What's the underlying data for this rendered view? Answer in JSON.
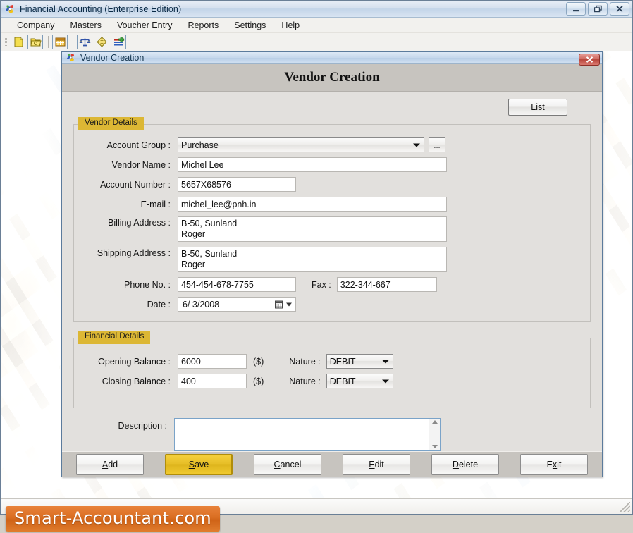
{
  "app": {
    "title": "Financial Accounting (Enterprise Edition)",
    "icon": "app-logo-icon",
    "window_buttons": {
      "minimize": "Minimize",
      "restore": "Restore",
      "close": "Close"
    },
    "menu": [
      {
        "label": "Company"
      },
      {
        "label": "Masters"
      },
      {
        "label": "Voucher Entry"
      },
      {
        "label": "Reports"
      },
      {
        "label": "Settings"
      },
      {
        "label": "Help"
      }
    ],
    "toolbar": [
      {
        "name": "new-document-icon",
        "tip": "New"
      },
      {
        "name": "open-folder-icon",
        "tip": "Open"
      },
      {
        "name": "calendar-grid-icon",
        "tip": "Calendar"
      },
      {
        "name": "balance-scale-icon",
        "tip": "Trial Balance"
      },
      {
        "name": "ledger-book-icon",
        "tip": "Ledger"
      },
      {
        "name": "add-entry-icon",
        "tip": "Add Entry"
      }
    ]
  },
  "dialog": {
    "titlebar_text": "Vendor Creation",
    "close_label": "x",
    "heading": "Vendor Creation",
    "list_button": {
      "prefix": "",
      "accel": "L",
      "rest": "ist",
      "full": "List"
    },
    "vendor_details": {
      "legend": "Vendor Details",
      "fields": {
        "account_group": {
          "label": "Account Group :",
          "value": "Purchase",
          "browse_label": "..."
        },
        "vendor_name": {
          "label": "Vendor Name :",
          "value": "Michel Lee"
        },
        "account_number": {
          "label": "Account Number :",
          "value": "5657X68576"
        },
        "email": {
          "label": "E-mail :",
          "value": "michel_lee@pnh.in"
        },
        "billing_address": {
          "label": "Billing Address :",
          "value": " B-50, Sunland\nRoger"
        },
        "shipping_address": {
          "label": "Shipping Address :",
          "value": " B-50, Sunland\nRoger"
        },
        "phone": {
          "label": "Phone No. :",
          "value": "454-454-678-7755"
        },
        "fax": {
          "label": "Fax :",
          "value": "322-344-667"
        },
        "date": {
          "label": "Date :",
          "value": "6/  3/2008"
        }
      }
    },
    "financial_details": {
      "legend": "Financial Details",
      "fields": {
        "opening_balance": {
          "label": "Opening Balance :",
          "value": "6000",
          "currency": "($)"
        },
        "opening_nature": {
          "label": "Nature :",
          "value": "DEBIT"
        },
        "closing_balance": {
          "label": "Closing Balance :",
          "value": "400",
          "currency": "($)"
        },
        "closing_nature": {
          "label": "Nature :",
          "value": "DEBIT"
        }
      }
    },
    "description": {
      "label": "Description :",
      "value": "",
      "placeholder": ""
    },
    "footer_buttons": [
      {
        "name": "add-button",
        "accel": "A",
        "before": "",
        "after": "dd",
        "full": "Add",
        "primary": false
      },
      {
        "name": "save-button",
        "accel": "S",
        "before": "",
        "after": "ave",
        "full": "Save",
        "primary": true
      },
      {
        "name": "cancel-button",
        "accel": "C",
        "before": "",
        "after": "ancel",
        "full": "Cancel",
        "primary": false
      },
      {
        "name": "edit-button",
        "accel": "E",
        "before": "",
        "after": "dit",
        "full": "Edit",
        "primary": false
      },
      {
        "name": "delete-button",
        "accel": "D",
        "before": "",
        "after": "elete",
        "full": "Delete",
        "primary": false
      },
      {
        "name": "exit-button",
        "accel": "x",
        "before": "E",
        "after": "it",
        "full": "Exit",
        "primary": false
      }
    ]
  },
  "watermark": {
    "text": "Smart-Accountant.com"
  },
  "colors": {
    "legend_yellow": "#dcb734",
    "save_yellow": "#e7bf28",
    "watermark_orange": "#da6e22",
    "close_red": "#b8453b",
    "titlebar_blue": "#c3d4e8"
  }
}
